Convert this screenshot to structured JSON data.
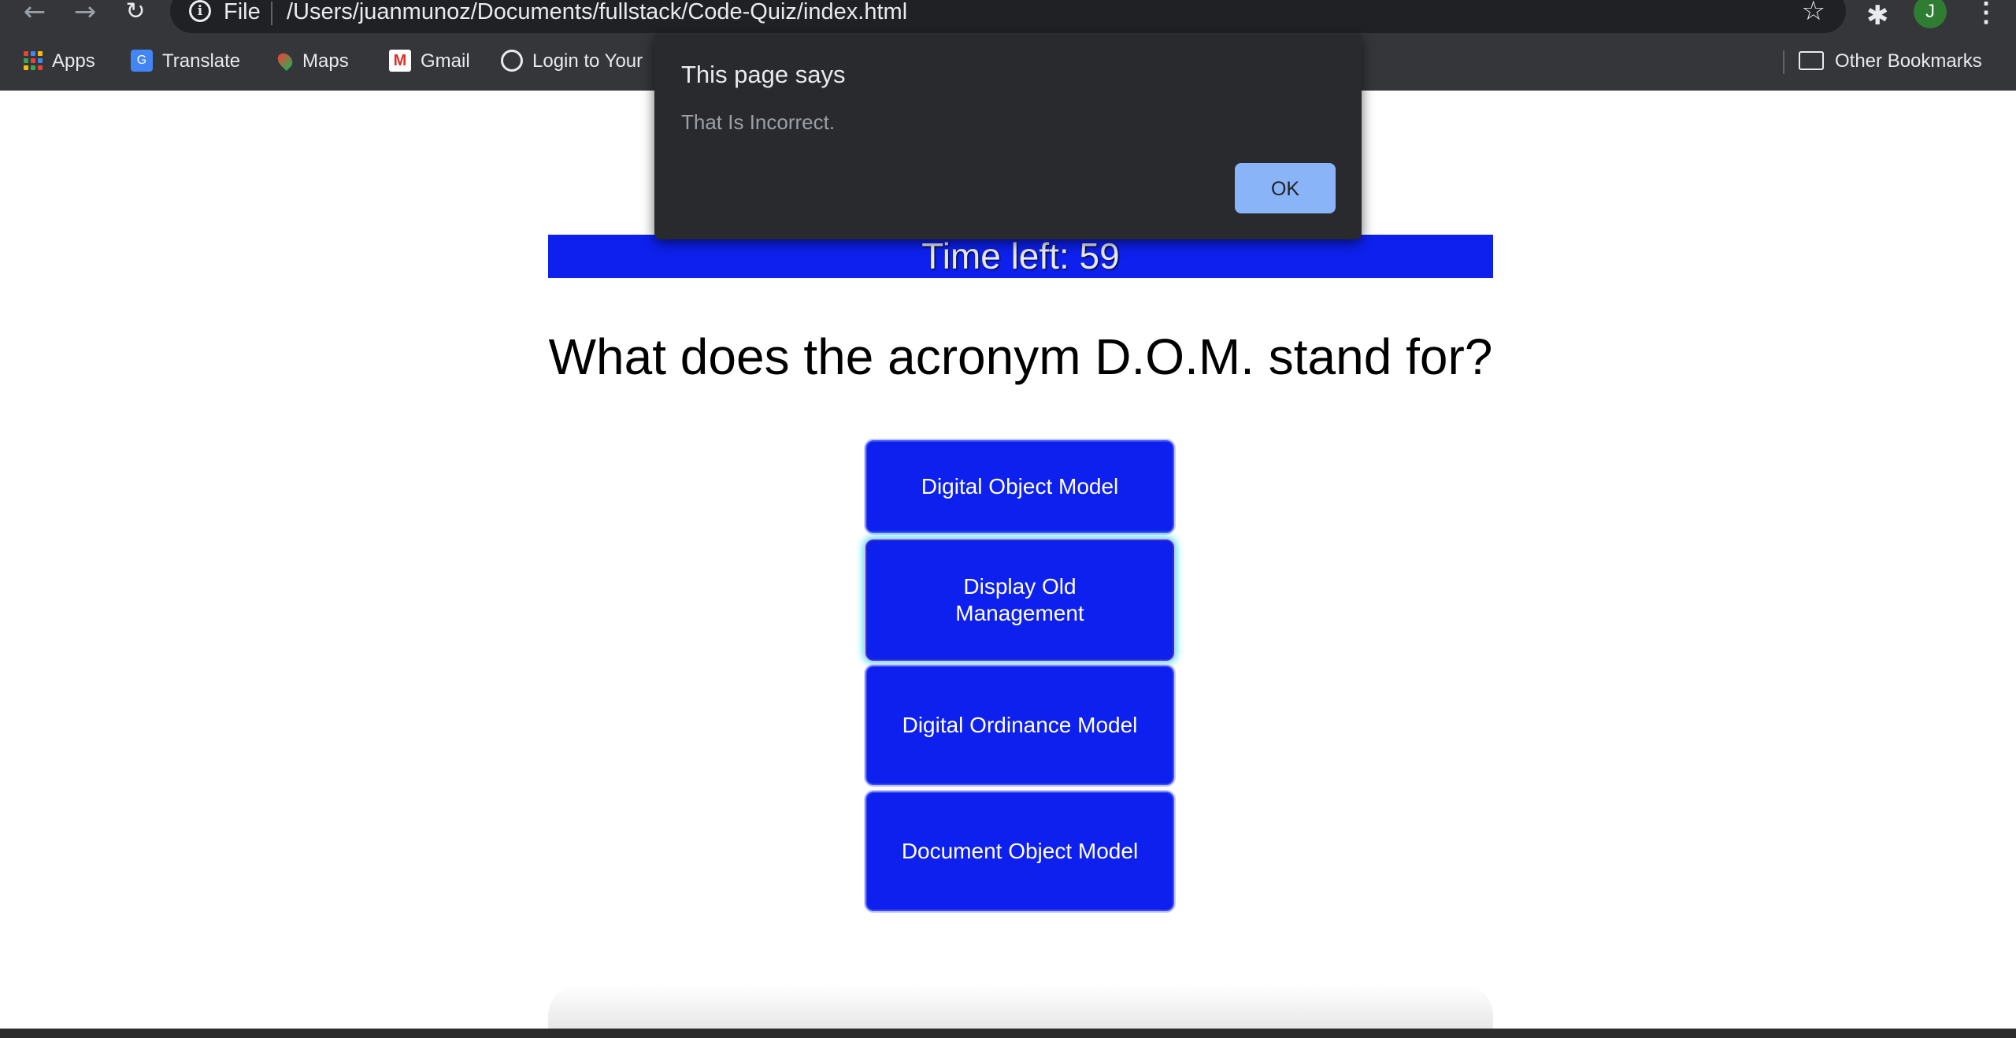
{
  "browser": {
    "back_glyph": "←",
    "forward_glyph": "→",
    "reload_glyph": "↻",
    "url_scheme": "File",
    "url": "/Users/juanmunoz/Documents/fullstack/Code-Quiz/index.html",
    "star_glyph": "☆",
    "extensions_glyph": "✱",
    "profile_initial": "J",
    "menu_glyph": "⋮"
  },
  "bookmarks": {
    "apps": "Apps",
    "translate": "Translate",
    "maps": "Maps",
    "gmail": "Gmail",
    "login": "Login to Your",
    "other": "Other Bookmarks"
  },
  "dialog": {
    "title": "This page says",
    "message": "That Is Incorrect.",
    "ok_label": "OK"
  },
  "quiz": {
    "timer": "Time left: 59",
    "question": "What does the acronym D.O.M. stand for?",
    "answers": [
      "Digital Object Model",
      "Display Old Management",
      "Digital Ordinance Model",
      "Document Object Model"
    ],
    "accent_color": "#0d20ed"
  }
}
